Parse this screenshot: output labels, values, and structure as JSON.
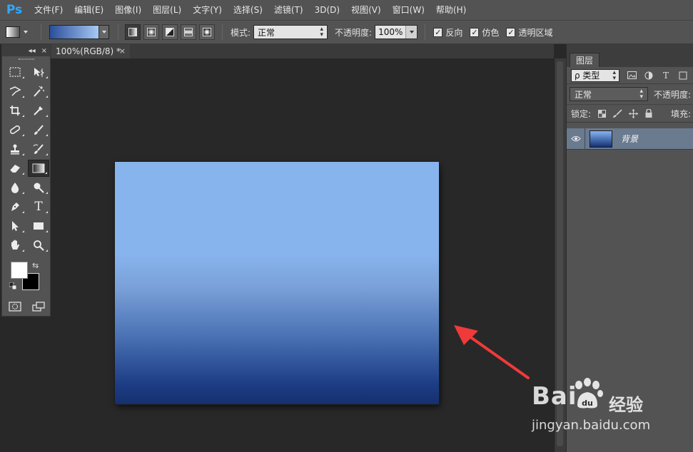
{
  "app": {
    "logo": "Ps",
    "menu": [
      "文件(F)",
      "编辑(E)",
      "图像(I)",
      "图层(L)",
      "文字(Y)",
      "选择(S)",
      "滤镜(T)",
      "3D(D)",
      "视图(V)",
      "窗口(W)",
      "帮助(H)"
    ]
  },
  "options": {
    "gradient_from": "#2a4f9a",
    "gradient_to": "#a8c8f4",
    "mode_label": "模式:",
    "mode_value": "正常",
    "opacity_label": "不透明度:",
    "opacity_value": "100%",
    "checkboxes": [
      {
        "label": "反向",
        "checked": true
      },
      {
        "label": "仿色",
        "checked": true
      },
      {
        "label": "透明区域",
        "checked": true
      }
    ],
    "gradient_types": [
      "linear",
      "radial",
      "angle",
      "reflected",
      "diamond"
    ],
    "active_gradient_type": 0
  },
  "document": {
    "tab_title": "100%(RGB/8) *",
    "tab_close": "×",
    "canvas_gradient_stops": [
      "#88b4ee",
      "#88b4ee",
      "#7aa0d8",
      "#4a72b4",
      "#1c3c84",
      "#16306e"
    ]
  },
  "toolbox": {
    "head_collapse": "◂◂",
    "head_close": "×",
    "rows": [
      [
        "marquee-icon",
        "move-icon"
      ],
      [
        "lasso-icon",
        "magic-wand-icon"
      ],
      [
        "crop-icon",
        "eyedropper-icon"
      ],
      [
        "healing-icon",
        "brush-icon"
      ],
      [
        "stamp-icon",
        "history-brush-icon"
      ],
      [
        "eraser-icon",
        "gradient-icon"
      ],
      [
        "blur-icon",
        "dodge-icon"
      ],
      [
        "pen-icon",
        "type-icon"
      ],
      [
        "path-select-icon",
        "rectangle-icon"
      ],
      [
        "hand-icon",
        "zoom-icon"
      ]
    ],
    "active_tool": "gradient-icon",
    "type_glyph": "T",
    "foreground": "#ffffff",
    "background": "#000000"
  },
  "layers_panel": {
    "tab": "图层",
    "filter_label": "ρ 类型",
    "blend_mode": "正常",
    "opacity_label": "不透明度:",
    "lock_label": "锁定:",
    "fill_label": "填充:",
    "layer_name": "背景"
  },
  "annotation": {
    "arrow_color": "#f03a3a"
  },
  "watermark": {
    "brand": "Bai",
    "brand_du": "du",
    "brand_cn": "经验",
    "url": "jingyan.baidu.com"
  }
}
